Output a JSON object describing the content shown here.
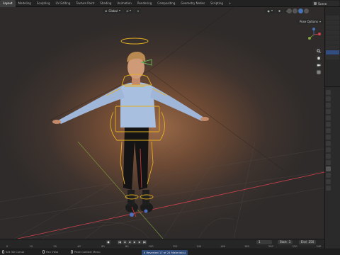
{
  "topbar": {
    "workspace_tabs": [
      "Layout",
      "Modeling",
      "Sculpting",
      "UV Editing",
      "Texture Paint",
      "Shading",
      "Animation",
      "Rendering",
      "Compositing",
      "Geometry Nodes",
      "Scripting",
      "+"
    ],
    "active_tab": "Layout",
    "scene_label": "Scene"
  },
  "viewport": {
    "header": {
      "view_mode": "Global",
      "pose_options": "Pose Options"
    },
    "colors": {
      "bone_outline": "#e6b022",
      "bone_selected": "#5fb356",
      "axis_x": "#d0424f",
      "axis_y": "#7fa23b",
      "accent": "#4772b3"
    },
    "icons": {
      "zoom": "zoom-icon",
      "pan": "hand-icon",
      "camera": "camera-icon",
      "perspective": "grid-icon"
    }
  },
  "timeline": {
    "playback_icons": [
      "jump-start-icon",
      "prev-key-icon",
      "play-reverse-icon",
      "play-icon",
      "next-key-icon",
      "jump-end-icon"
    ],
    "current_frame": "1",
    "start_label": "Start",
    "start_value": "1",
    "end_label": "End",
    "end_value": "250",
    "ruler_ticks": [
      "0",
      "10",
      "20",
      "40",
      "60",
      "80",
      "100",
      "120",
      "140",
      "160",
      "180",
      "200",
      "220",
      "240"
    ]
  },
  "statusbar": {
    "left_hint": "Set 3D Cursor",
    "mid_hint": "Pan View",
    "ctx_hint": "Pose Context Menu",
    "report": "Reverted 17 of 24 Material(s)"
  }
}
